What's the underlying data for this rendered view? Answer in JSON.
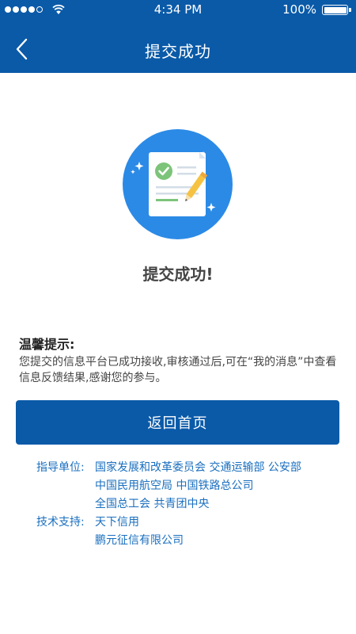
{
  "status_bar": {
    "time": "4:34 PM",
    "battery": "100%"
  },
  "nav": {
    "title": "提交成功"
  },
  "success": {
    "message": "提交成功!"
  },
  "tips": {
    "title": "温馨提示:",
    "body": "您提交的信息平台已成功接收,审核通过后,可在“我的消息”中查看信息反馈结果,感谢您的参与。"
  },
  "home_button": {
    "label": "返回首页"
  },
  "footer": {
    "guidance": {
      "label": "指导单位:",
      "lines": [
        "国家发展和改革委员会 交通运输部 公安部",
        "中国民用航空局 中国铁路总公司",
        "全国总工会 共青团中央"
      ]
    },
    "support": {
      "label": "技术支持:",
      "lines": [
        "天下信用",
        "鹏元征信有限公司"
      ]
    }
  },
  "icons": [
    "back-arrow-icon",
    "success-document-icon",
    "signal-icon",
    "wifi-icon",
    "battery-icon"
  ],
  "colors": {
    "primary": "#0a5aa8",
    "circle": "#2b8ae6",
    "check": "#7cc47a",
    "pencil": "#f5c242",
    "link": "#1a6fbf"
  }
}
